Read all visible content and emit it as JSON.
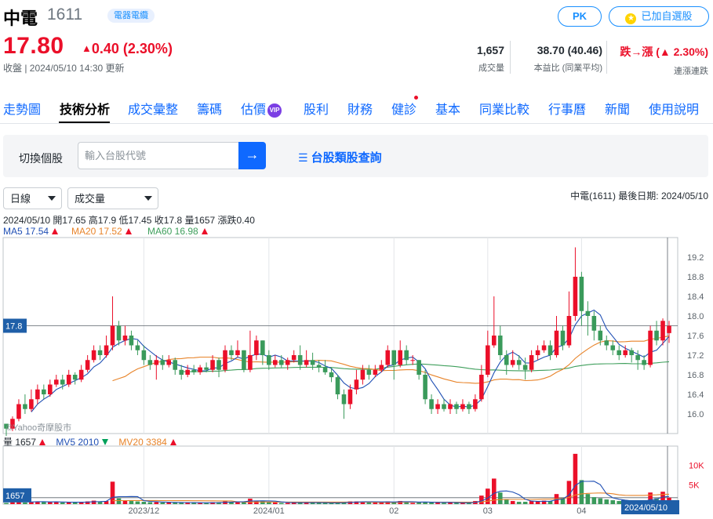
{
  "stock": {
    "name": "中電",
    "code": "1611",
    "category": "電器電纜",
    "price": "17.80",
    "change": "0.40 (2.30%)",
    "update_time": "收盤 | 2024/05/10 14:30 更新"
  },
  "buttons": {
    "pk": "PK",
    "watchlist": "已加自選股"
  },
  "stats": [
    {
      "value": "1,657",
      "label": "成交量"
    },
    {
      "value": "38.70 (40.46)",
      "label": "本益比 (同業平均)"
    },
    {
      "value": "跌→漲 (▲ 2.30%)",
      "label": "連漲連跌"
    }
  ],
  "nav": {
    "tabs": [
      "走勢圖",
      "技術分析",
      "成交彙整",
      "籌碼",
      "估價",
      "股利",
      "財務",
      "健診",
      "基本",
      "同業比較",
      "行事曆",
      "新聞",
      "使用說明"
    ],
    "vip_badge": "VIP",
    "active": "技術分析"
  },
  "search": {
    "label": "切換個股",
    "placeholder": "輸入台股代號",
    "category_link": "台股類股查詢"
  },
  "controls": {
    "period": "日線",
    "indicator": "成交量"
  },
  "chart_header": {
    "info_right": "中電(1611)  最後日期: 2024/05/10",
    "ohlc": "2024/05/10 開17.65 高17.9 低17.45 收17.8 量1657 漲跌0.40",
    "ma5": "MA5 17.54",
    "ma20": "MA20 17.52",
    "ma60": "MA60 16.98",
    "vol": "量 1657",
    "mv5": "MV5 2010",
    "mv20": "MV20 3384"
  },
  "colors": {
    "up": "#eb0f29",
    "down": "#3a9a5b",
    "ma5": "#1f4fb4",
    "ma20": "#e8842a",
    "ma60": "#3f9f5c",
    "accent": "#0f69ff"
  },
  "chart_data": {
    "type": "candlestick",
    "price_axis": {
      "ticks": [
        16.0,
        16.4,
        16.8,
        17.2,
        17.6,
        18.0,
        18.4,
        18.8,
        19.2
      ],
      "ylim": [
        15.6,
        19.6
      ]
    },
    "volume_axis": {
      "ticks": [
        "5K",
        "10K"
      ],
      "ylim": [
        0,
        15000
      ]
    },
    "x_labels": [
      "2023/12",
      "2024/01",
      "02",
      "03",
      "04"
    ],
    "current_price_label": "17.8",
    "current_volume_label": "1657",
    "last_date_label": "2024/05/10",
    "watermark": "©Yahoo奇摩股市",
    "candles": [
      [
        15.8,
        15.7,
        15.75,
        15.55,
        300
      ],
      [
        15.7,
        15.9,
        15.95,
        15.65,
        500
      ],
      [
        15.9,
        16.2,
        16.3,
        15.85,
        900
      ],
      [
        16.2,
        16.1,
        16.4,
        16.0,
        400
      ],
      [
        16.1,
        16.3,
        16.5,
        16.05,
        600
      ],
      [
        16.3,
        16.5,
        16.6,
        16.2,
        700
      ],
      [
        16.5,
        16.4,
        16.6,
        16.3,
        500
      ],
      [
        16.4,
        16.6,
        16.7,
        16.35,
        600
      ],
      [
        16.6,
        16.7,
        16.8,
        16.55,
        500
      ],
      [
        16.7,
        16.6,
        16.8,
        16.5,
        400
      ],
      [
        16.6,
        16.8,
        16.9,
        16.55,
        500
      ],
      [
        16.8,
        16.7,
        16.85,
        16.6,
        400
      ],
      [
        16.7,
        16.9,
        17.0,
        16.65,
        600
      ],
      [
        16.9,
        17.1,
        17.2,
        16.85,
        700
      ],
      [
        17.1,
        17.3,
        17.4,
        17.05,
        900
      ],
      [
        17.3,
        17.2,
        17.4,
        17.1,
        600
      ],
      [
        17.2,
        17.4,
        17.6,
        17.15,
        800
      ],
      [
        17.4,
        17.8,
        18.4,
        17.3,
        5800
      ],
      [
        17.8,
        17.5,
        17.9,
        17.4,
        1500
      ],
      [
        17.5,
        17.6,
        17.8,
        17.4,
        900
      ],
      [
        17.6,
        17.4,
        17.7,
        17.3,
        800
      ],
      [
        17.4,
        17.3,
        17.5,
        17.2,
        700
      ],
      [
        17.3,
        17.1,
        17.4,
        17.0,
        600
      ],
      [
        17.1,
        17.0,
        17.2,
        16.9,
        500
      ],
      [
        17.0,
        17.1,
        17.2,
        16.7,
        500
      ],
      [
        17.1,
        17.0,
        17.2,
        16.9,
        400
      ],
      [
        17.0,
        17.1,
        17.2,
        16.95,
        400
      ],
      [
        17.1,
        16.9,
        17.15,
        16.8,
        400
      ],
      [
        16.9,
        16.8,
        17.0,
        16.7,
        400
      ],
      [
        16.8,
        16.9,
        17.0,
        16.75,
        400
      ],
      [
        16.9,
        16.85,
        17.0,
        16.8,
        300
      ],
      [
        16.85,
        16.95,
        17.0,
        16.8,
        300
      ],
      [
        16.95,
        16.9,
        17.05,
        16.85,
        300
      ],
      [
        16.9,
        17.1,
        17.2,
        16.85,
        500
      ],
      [
        17.1,
        16.9,
        17.15,
        16.75,
        500
      ],
      [
        16.9,
        17.3,
        17.4,
        16.85,
        700
      ],
      [
        17.3,
        17.2,
        17.4,
        17.1,
        600
      ],
      [
        17.2,
        17.3,
        17.5,
        17.15,
        600
      ],
      [
        17.3,
        16.9,
        17.3,
        16.85,
        700
      ],
      [
        16.9,
        17.2,
        17.7,
        16.85,
        1400
      ],
      [
        17.2,
        17.5,
        17.6,
        17.1,
        900
      ],
      [
        17.5,
        17.2,
        17.5,
        17.0,
        700
      ],
      [
        17.2,
        17.0,
        17.3,
        16.9,
        500
      ],
      [
        17.0,
        17.1,
        17.2,
        16.95,
        400
      ],
      [
        17.1,
        17.0,
        17.2,
        16.95,
        300
      ],
      [
        17.0,
        17.1,
        17.15,
        16.9,
        300
      ],
      [
        17.1,
        17.2,
        17.3,
        17.05,
        400
      ],
      [
        17.2,
        17.0,
        17.4,
        16.9,
        500
      ],
      [
        17.0,
        17.1,
        17.3,
        16.95,
        400
      ],
      [
        17.1,
        17.0,
        17.25,
        16.9,
        300
      ],
      [
        17.0,
        16.95,
        17.1,
        16.85,
        300
      ],
      [
        16.95,
        16.85,
        17.1,
        16.8,
        300
      ],
      [
        16.85,
        16.75,
        16.95,
        16.65,
        300
      ],
      [
        16.75,
        16.4,
        16.8,
        16.3,
        400
      ],
      [
        16.4,
        16.2,
        16.5,
        15.9,
        500
      ],
      [
        16.2,
        16.5,
        16.6,
        16.1,
        700
      ],
      [
        16.5,
        16.7,
        16.9,
        16.4,
        700
      ],
      [
        16.7,
        16.9,
        17.0,
        16.6,
        600
      ],
      [
        16.9,
        16.8,
        17.0,
        16.7,
        500
      ],
      [
        16.8,
        16.9,
        17.0,
        16.75,
        500
      ],
      [
        16.9,
        17.0,
        17.1,
        16.85,
        500
      ],
      [
        17.0,
        17.3,
        17.4,
        16.95,
        700
      ],
      [
        17.3,
        17.0,
        17.3,
        16.7,
        500
      ],
      [
        17.0,
        17.3,
        17.5,
        16.95,
        800
      ],
      [
        17.3,
        17.1,
        17.4,
        17.0,
        600
      ],
      [
        17.1,
        17.1,
        17.2,
        17.0,
        300
      ],
      [
        17.1,
        16.8,
        17.1,
        16.7,
        400
      ],
      [
        16.8,
        16.3,
        16.9,
        16.2,
        600
      ],
      [
        16.3,
        16.1,
        16.4,
        16.0,
        500
      ],
      [
        16.1,
        16.2,
        16.3,
        16.0,
        400
      ],
      [
        16.2,
        16.1,
        16.3,
        16.05,
        300
      ],
      [
        16.1,
        16.2,
        16.3,
        16.0,
        400
      ],
      [
        16.2,
        16.1,
        16.25,
        16.0,
        300
      ],
      [
        16.1,
        16.2,
        16.3,
        16.05,
        300
      ],
      [
        16.2,
        16.1,
        16.25,
        16.0,
        400
      ],
      [
        16.1,
        16.3,
        16.4,
        16.05,
        800
      ],
      [
        16.3,
        16.8,
        17.0,
        16.25,
        2200
      ],
      [
        16.8,
        17.4,
        17.7,
        16.75,
        4000
      ],
      [
        17.4,
        17.6,
        18.4,
        17.35,
        6600
      ],
      [
        17.6,
        17.2,
        17.8,
        17.1,
        3000
      ],
      [
        17.2,
        17.0,
        17.3,
        16.8,
        1200
      ],
      [
        17.0,
        17.1,
        17.3,
        16.95,
        800
      ],
      [
        17.1,
        17.0,
        17.2,
        16.9,
        600
      ],
      [
        17.0,
        16.9,
        17.15,
        16.7,
        600
      ],
      [
        16.9,
        17.2,
        17.3,
        16.85,
        800
      ],
      [
        17.2,
        17.3,
        17.4,
        17.1,
        700
      ],
      [
        17.3,
        17.4,
        17.5,
        17.25,
        900
      ],
      [
        17.4,
        17.2,
        17.5,
        17.1,
        800
      ],
      [
        17.2,
        17.7,
        18.0,
        17.15,
        2600
      ],
      [
        17.7,
        17.4,
        17.8,
        17.3,
        1600
      ],
      [
        17.4,
        18.0,
        18.5,
        17.35,
        6000
      ],
      [
        18.0,
        18.8,
        19.4,
        17.9,
        13000
      ],
      [
        18.8,
        18.1,
        18.9,
        17.8,
        6200
      ],
      [
        18.1,
        18.0,
        18.3,
        17.6,
        2600
      ],
      [
        18.0,
        17.7,
        18.1,
        17.5,
        1800
      ],
      [
        17.7,
        17.5,
        17.8,
        17.4,
        1500
      ],
      [
        17.5,
        17.4,
        17.6,
        17.3,
        1200
      ],
      [
        17.4,
        17.3,
        17.5,
        17.2,
        1000
      ],
      [
        17.3,
        17.2,
        17.4,
        17.1,
        800
      ],
      [
        17.2,
        17.3,
        17.4,
        17.15,
        700
      ],
      [
        17.3,
        17.2,
        17.35,
        17.05,
        600
      ],
      [
        17.2,
        17.1,
        17.3,
        16.9,
        800
      ],
      [
        17.1,
        17.0,
        17.2,
        16.9,
        600
      ],
      [
        17.0,
        17.7,
        17.8,
        16.95,
        3000
      ],
      [
        17.7,
        17.5,
        17.9,
        17.4,
        1500
      ],
      [
        17.5,
        17.9,
        17.95,
        17.4,
        3200
      ],
      [
        17.65,
        17.8,
        17.9,
        17.45,
        1657
      ]
    ]
  }
}
